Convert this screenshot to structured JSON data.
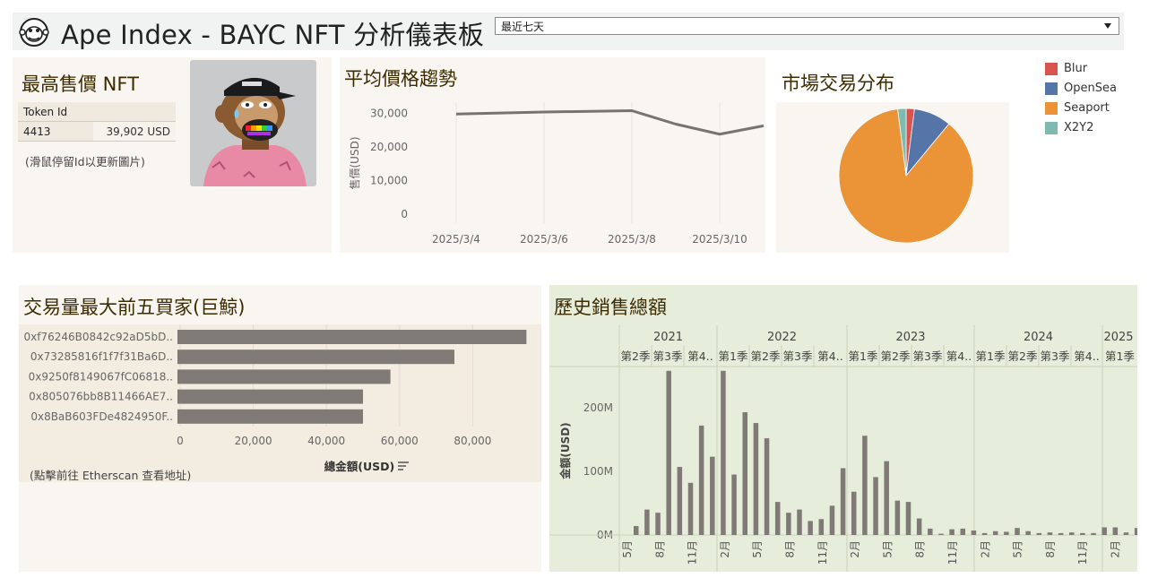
{
  "header": {
    "title": "Ape Index - BAYC NFT 分析儀表板",
    "range_value": "最近七天"
  },
  "top_sale": {
    "title": "最高售價 NFT",
    "table_header": "Token Id",
    "token_id": "4413",
    "price": "39,902 USD",
    "hint": "(滑鼠停留Id以更新圖片)"
  },
  "avg_price": {
    "title": "平均價格趨勢"
  },
  "market": {
    "title": "市場交易分布"
  },
  "buyers": {
    "title": "交易量最大前五買家(巨鯨)",
    "hint": "(點擊前往 Etherscan 查看地址)"
  },
  "history": {
    "title": "歷史銷售總額"
  },
  "colors": {
    "blur": "#d9534f",
    "opensea": "#5575a8",
    "seaport": "#eb9437",
    "x2y2": "#7fbab0",
    "bar": "#7f7a75",
    "line": "#777370"
  },
  "chart_data": [
    {
      "type": "line",
      "x": [
        "2025/3/4",
        "2025/3/6",
        "2025/3/8",
        "2025/3/9",
        "2025/3/10",
        "2025/3/11"
      ],
      "values": [
        29800,
        30400,
        30800,
        26800,
        23800,
        26300
      ],
      "xticks": [
        "2025/3/4",
        "2025/3/6",
        "2025/3/8",
        "2025/3/10"
      ],
      "yticks": [
        "30,000",
        "20,000",
        "10,000",
        "0"
      ],
      "ylabel": "售價(USD)",
      "ylim": [
        0,
        32000
      ]
    },
    {
      "type": "pie",
      "labels": [
        "Blur",
        "OpenSea",
        "Seaport",
        "X2Y2"
      ],
      "values": [
        2.0,
        9.0,
        87.0,
        2.0
      ],
      "legend": "top-right"
    },
    {
      "type": "bar",
      "orientation": "horizontal",
      "categories": [
        "0xf76246B0842c92aD5bD..",
        "0x73285816f1f7f31Ba6D..",
        "0x9250f8149067fC06818..",
        "0x805076bb8B11466AE7..",
        "0x8BaB603FDe4824950F.."
      ],
      "values": [
        94700,
        75000,
        57500,
        50000,
        50000
      ],
      "xticks": [
        "0",
        "20,000",
        "40,000",
        "60,000",
        "80,000"
      ],
      "xlabel": "總金額(USD)",
      "xlim": [
        0,
        100000
      ]
    },
    {
      "type": "bar",
      "years": [
        "2021",
        "2022",
        "2023",
        "2024",
        "2025"
      ],
      "quarters": [
        "第2季",
        "第3季",
        "第4..",
        "第1季",
        "第2季",
        "第3季",
        "第4..",
        "第1季",
        "第2季",
        "第3季",
        "第4..",
        "第1季",
        "第2季",
        "第3季",
        "第4..",
        "第1季"
      ],
      "month_ticks": [
        "5月",
        "8月",
        "11月",
        "2月",
        "5月",
        "8月",
        "11月",
        "2月",
        "5月",
        "8月",
        "11月",
        "2月",
        "5月",
        "8月",
        "11月",
        "2月"
      ],
      "values": [
        14,
        40,
        35,
        258,
        107,
        82,
        172,
        123,
        258,
        95,
        193,
        176,
        152,
        52,
        35,
        40,
        22,
        25,
        46,
        105,
        68,
        156,
        91,
        116,
        54,
        52,
        26,
        10,
        2,
        9,
        10,
        7,
        3,
        6,
        5,
        11,
        6,
        3,
        4,
        3,
        4,
        3,
        3,
        12,
        12,
        4,
        11,
        2
      ],
      "yticks": [
        "200M",
        "100M",
        "0M"
      ],
      "ylabel": "金額(USD)",
      "ylim": [
        0,
        300
      ]
    }
  ]
}
